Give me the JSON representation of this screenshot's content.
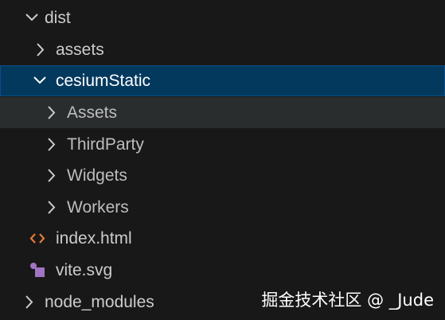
{
  "explorer": {
    "items": [
      {
        "label": "dist",
        "icon": "chevron-down-icon",
        "state": "expanded"
      },
      {
        "label": "assets",
        "icon": "chevron-right-icon",
        "state": "collapsed"
      },
      {
        "label": "cesiumStatic",
        "icon": "chevron-down-icon",
        "state": "expanded-selected"
      },
      {
        "label": "Assets",
        "icon": "chevron-right-icon",
        "state": "collapsed-hovered"
      },
      {
        "label": "ThirdParty",
        "icon": "chevron-right-icon",
        "state": "collapsed"
      },
      {
        "label": "Widgets",
        "icon": "chevron-right-icon",
        "state": "collapsed"
      },
      {
        "label": "Workers",
        "icon": "chevron-right-icon",
        "state": "collapsed"
      },
      {
        "label": "index.html",
        "icon": "html-file-icon",
        "state": "file"
      },
      {
        "label": "vite.svg",
        "icon": "svg-file-icon",
        "state": "file"
      },
      {
        "label": "node_modules",
        "icon": "chevron-right-icon",
        "state": "collapsed"
      }
    ]
  },
  "watermark": {
    "text": "掘金技术社区 @ _Jude"
  },
  "colors": {
    "background": "#181818",
    "selected_background": "#04395e",
    "selected_border": "#0a4f86",
    "hover_background": "#2a2d2e",
    "text": "#cccccc",
    "html_icon": "#e37933",
    "svg_icon": "#a074c4"
  }
}
